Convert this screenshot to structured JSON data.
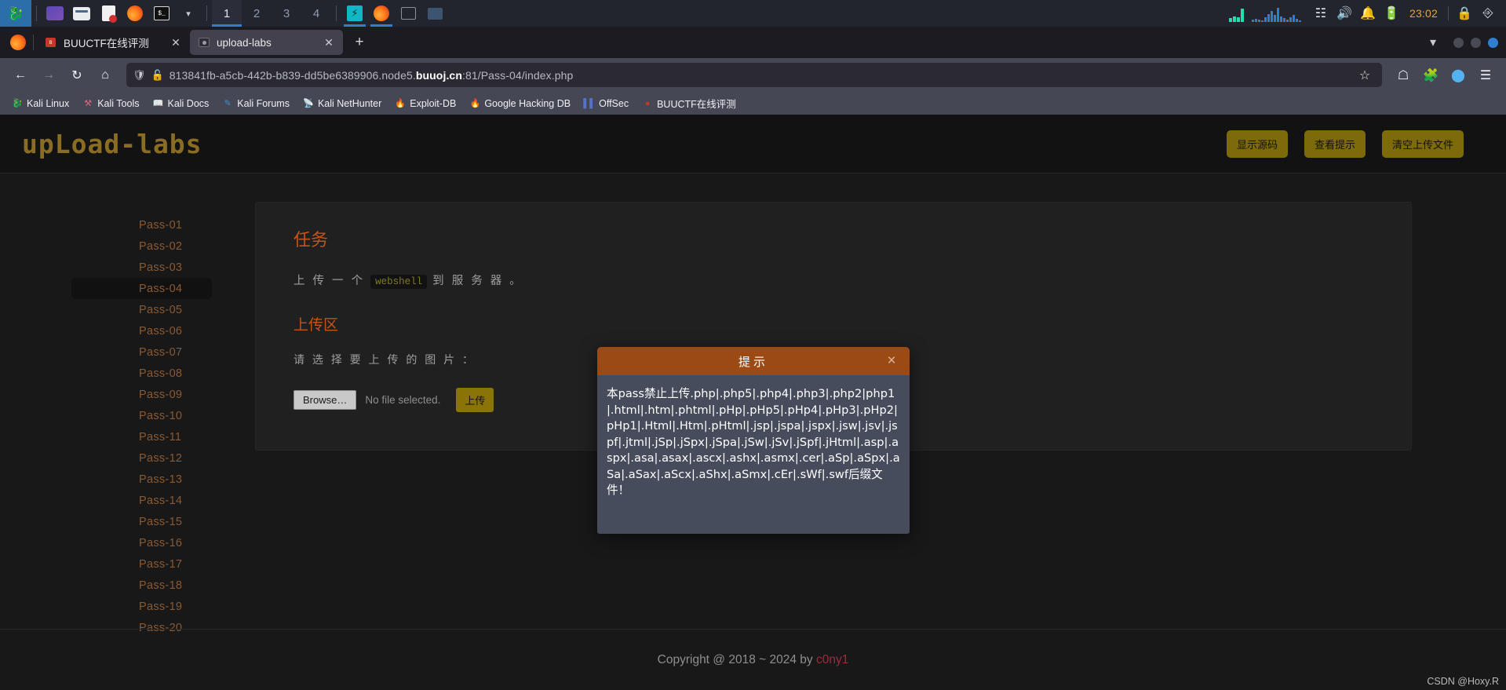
{
  "taskbar": {
    "workspaces": [
      "1",
      "2",
      "3",
      "4"
    ],
    "active_workspace": "1",
    "clock": "23:02",
    "launchers": [
      "kali-menu-icon",
      "files-icon",
      "folder-icon",
      "document-icon",
      "firefox-icon",
      "terminal-icon",
      "chevron-down-icon"
    ],
    "tray": [
      "network-icon",
      "volume-icon",
      "bell-icon",
      "battery-icon",
      "lock-icon",
      "logout-icon"
    ]
  },
  "browser": {
    "tabs": [
      {
        "title": "BUUCTF在线评测",
        "favicon": "buuctf-favicon",
        "active": false
      },
      {
        "title": "upload-labs",
        "favicon": "camera-favicon",
        "active": true
      }
    ],
    "newtab_label": "+",
    "url": {
      "prefix": "813841fb-a5cb-442b-b839-dd5be6389906.node5.",
      "host": "buuoj.cn",
      "suffix": ":81/Pass-04/index.php"
    },
    "nav": [
      "back-icon",
      "forward-icon",
      "reload-icon",
      "home-icon"
    ],
    "toolbar_right": [
      "pocket-icon",
      "extensions-icon",
      "account-icon",
      "menu-icon"
    ],
    "bookmarks": [
      {
        "label": "Kali Linux",
        "icon": "kali-dragon-icon"
      },
      {
        "label": "Kali Tools",
        "icon": "kali-tools-icon"
      },
      {
        "label": "Kali Docs",
        "icon": "kali-docs-icon"
      },
      {
        "label": "Kali Forums",
        "icon": "kali-forums-icon"
      },
      {
        "label": "Kali NetHunter",
        "icon": "kali-nethunter-icon"
      },
      {
        "label": "Exploit-DB",
        "icon": "exploitdb-icon"
      },
      {
        "label": "Google Hacking DB",
        "icon": "google-hacking-icon"
      },
      {
        "label": "OffSec",
        "icon": "offsec-icon"
      },
      {
        "label": "BUUCTF在线评测",
        "icon": "buuctf-icon"
      }
    ]
  },
  "site": {
    "logo": "upLoad-labs",
    "header_buttons": [
      {
        "label": "显示源码"
      },
      {
        "label": "查看提示"
      },
      {
        "label": "清空上传文件"
      }
    ],
    "passes": [
      {
        "label": "Pass-01",
        "active": false
      },
      {
        "label": "Pass-02",
        "active": false
      },
      {
        "label": "Pass-03",
        "active": false
      },
      {
        "label": "Pass-04",
        "active": true
      },
      {
        "label": "Pass-05",
        "active": false
      },
      {
        "label": "Pass-06",
        "active": false
      },
      {
        "label": "Pass-07",
        "active": false
      },
      {
        "label": "Pass-08",
        "active": false
      },
      {
        "label": "Pass-09",
        "active": false
      },
      {
        "label": "Pass-10",
        "active": false
      },
      {
        "label": "Pass-11",
        "active": false
      },
      {
        "label": "Pass-12",
        "active": false
      },
      {
        "label": "Pass-13",
        "active": false
      },
      {
        "label": "Pass-14",
        "active": false
      },
      {
        "label": "Pass-15",
        "active": false
      },
      {
        "label": "Pass-16",
        "active": false
      },
      {
        "label": "Pass-17",
        "active": false
      },
      {
        "label": "Pass-18",
        "active": false
      },
      {
        "label": "Pass-19",
        "active": false
      },
      {
        "label": "Pass-20",
        "active": false
      }
    ],
    "task_heading": "任务",
    "task_desc_before": "上 传 一 个 ",
    "task_desc_code": "webshell",
    "task_desc_after": " 到 服 务 器 。",
    "upload_heading": "上传区",
    "choose_label": "请 选 择 要 上 传 的 图 片 ：",
    "browse_label": "Browse…",
    "file_name": "No file selected.",
    "submit_label": "上传",
    "copyright_text": "Copyright @ 2018 ~ 2024 by ",
    "copyright_author": "c0ny1",
    "watermark": "CSDN @Hoxy.R"
  },
  "modal": {
    "title": "提示",
    "close_label": "×",
    "message": "本pass禁止上传.php|.php5|.php4|.php3|.php2|php1|.html|.htm|.phtml|.pHp|.pHp5|.pHp4|.pHp3|.pHp2|pHp1|.Html|.Htm|.pHtml|.jsp|.jspa|.jspx|.jsw|.jsv|.jspf|.jtml|.jSp|.jSpx|.jSpa|.jSw|.jSv|.jSpf|.jHtml|.asp|.aspx|.asa|.asax|.ascx|.ashx|.asmx|.cer|.aSp|.aSpx|.aSa|.aSax|.aScx|.aShx|.aSmx|.cEr|.sWf|.swf后缀文件！"
  },
  "colors": {
    "accent_orange": "#c4541a",
    "modal_header": "#9b4a14",
    "modal_body": "#464c5c",
    "button_gold": "#7d6a0b",
    "pass_link": "#8a5a33",
    "clock": "#e8a33d"
  }
}
